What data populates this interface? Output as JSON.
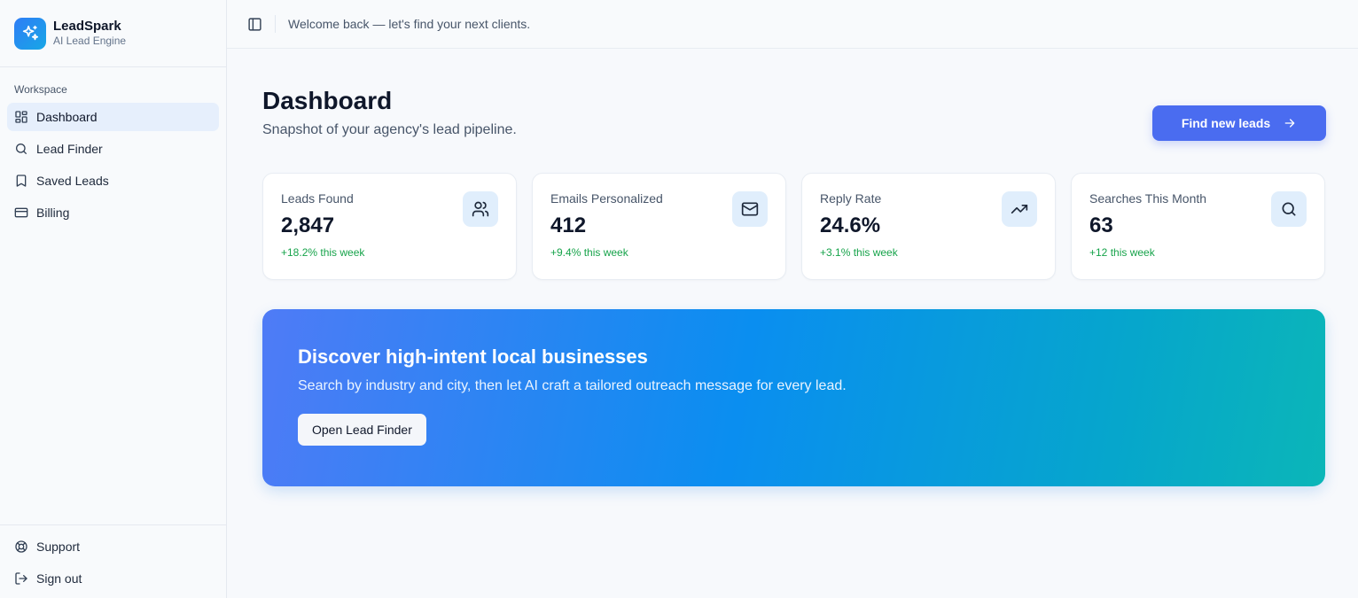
{
  "brand": {
    "name": "LeadSpark",
    "subtitle": "AI Lead Engine",
    "logo_icon": "sparkles-icon"
  },
  "sidebar": {
    "section_label": "Workspace",
    "items": [
      {
        "label": "Dashboard",
        "icon": "layout-grid-icon",
        "active": true
      },
      {
        "label": "Lead Finder",
        "icon": "search-icon",
        "active": false
      },
      {
        "label": "Saved Leads",
        "icon": "bookmark-icon",
        "active": false
      },
      {
        "label": "Billing",
        "icon": "credit-card-icon",
        "active": false
      }
    ],
    "footer": [
      {
        "label": "Support",
        "icon": "lifebuoy-icon"
      },
      {
        "label": "Sign out",
        "icon": "log-out-icon"
      }
    ]
  },
  "topbar": {
    "welcome": "Welcome back — let's find your next clients."
  },
  "page": {
    "title": "Dashboard",
    "subtitle": "Snapshot of your agency's lead pipeline.",
    "primary_button": "Find new leads"
  },
  "stats": [
    {
      "label": "Leads Found",
      "value": "2,847",
      "delta": "+18.2% this week",
      "icon": "users-icon"
    },
    {
      "label": "Emails Personalized",
      "value": "412",
      "delta": "+9.4% this week",
      "icon": "mail-icon"
    },
    {
      "label": "Reply Rate",
      "value": "24.6%",
      "delta": "+3.1% this week",
      "icon": "trending-up-icon"
    },
    {
      "label": "Searches This Month",
      "value": "63",
      "delta": "+12 this week",
      "icon": "search-icon"
    }
  ],
  "hero": {
    "title": "Discover high-intent local businesses",
    "subtitle": "Search by industry and city, then let AI craft a tailored outreach message for every lead.",
    "button": "Open Lead Finder"
  },
  "colors": {
    "accent": "#4a6cf0",
    "positive": "#16a34a",
    "icon_bg": "#e0eefc",
    "active_nav_bg": "#e6effc"
  }
}
